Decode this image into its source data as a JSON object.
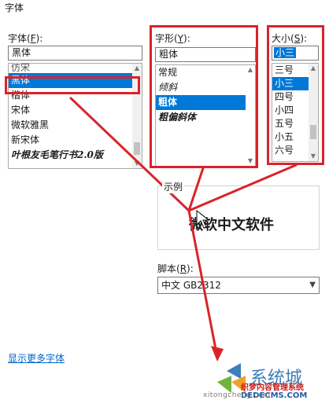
{
  "window": {
    "title": "字体"
  },
  "font": {
    "label": "字体(",
    "accel": "F",
    "label_end": "):",
    "value": "黑体",
    "items": [
      {
        "text": "仿宋",
        "cut": true
      },
      {
        "text": "黑体",
        "selected": true
      },
      {
        "text": "楷体"
      },
      {
        "text": "宋体"
      },
      {
        "text": "微软雅黑"
      },
      {
        "text": "新宋体"
      },
      {
        "text": "叶根友毛笔行书2.0版"
      }
    ]
  },
  "style": {
    "label": "字形(",
    "accel": "Y",
    "label_end": "):",
    "value": "粗体",
    "items": [
      {
        "text": "常规"
      },
      {
        "text": "倾斜"
      },
      {
        "text": "粗体",
        "selected": true
      },
      {
        "text": "粗偏斜体"
      }
    ]
  },
  "size": {
    "label": "大小(",
    "accel": "S",
    "label_end": "):",
    "value": "小三",
    "items": [
      {
        "text": "三号"
      },
      {
        "text": "小三",
        "selected": true
      },
      {
        "text": "四号"
      },
      {
        "text": "小四"
      },
      {
        "text": "五号"
      },
      {
        "text": "小五"
      },
      {
        "text": "六号"
      }
    ]
  },
  "preview": {
    "label": "示例",
    "text": "微软中文软件"
  },
  "script": {
    "label": "脚本(",
    "accel": "R",
    "label_end": "):",
    "value": "中文 GB2312"
  },
  "more_fonts_link": "显示更多字体",
  "watermark": {
    "tag": "xitongcheng.com",
    "logo_text": "系统城",
    "sub": "织梦内容管理系统",
    "url": "DEDECMS.COM"
  },
  "colors": {
    "selection": "#0078d7",
    "annotation": "#d9232a",
    "link": "#0066cc"
  }
}
